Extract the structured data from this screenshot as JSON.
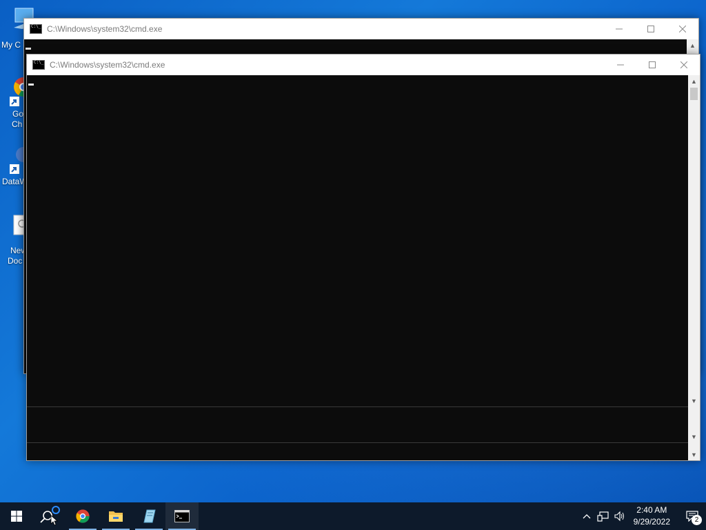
{
  "desktop": {
    "icons": [
      {
        "label_line1": "My C",
        "label_line2": ""
      },
      {
        "label_line1": "Go",
        "label_line2": "Ch"
      },
      {
        "label_line1": "DataW",
        "label_line2": ""
      },
      {
        "label_line1": "New",
        "label_line2": "Doc"
      }
    ]
  },
  "windows": {
    "back": {
      "title": "C:\\Windows\\system32\\cmd.exe"
    },
    "front": {
      "title": "C:\\Windows\\system32\\cmd.exe"
    }
  },
  "taskbar": {
    "start_icon": "windows-logo-icon",
    "search_icon": "search-icon",
    "apps": [
      "chrome-icon",
      "file-explorer-icon",
      "notepad-icon",
      "cmd-icon"
    ],
    "tray": {
      "time": "2:40 AM",
      "date": "9/29/2022",
      "notification_count": "2"
    }
  },
  "colors": {
    "console_bg": "#0c0c0c",
    "desktop_blue": "#0a5fc4",
    "taskbar_bg": "#0d1a2b"
  }
}
